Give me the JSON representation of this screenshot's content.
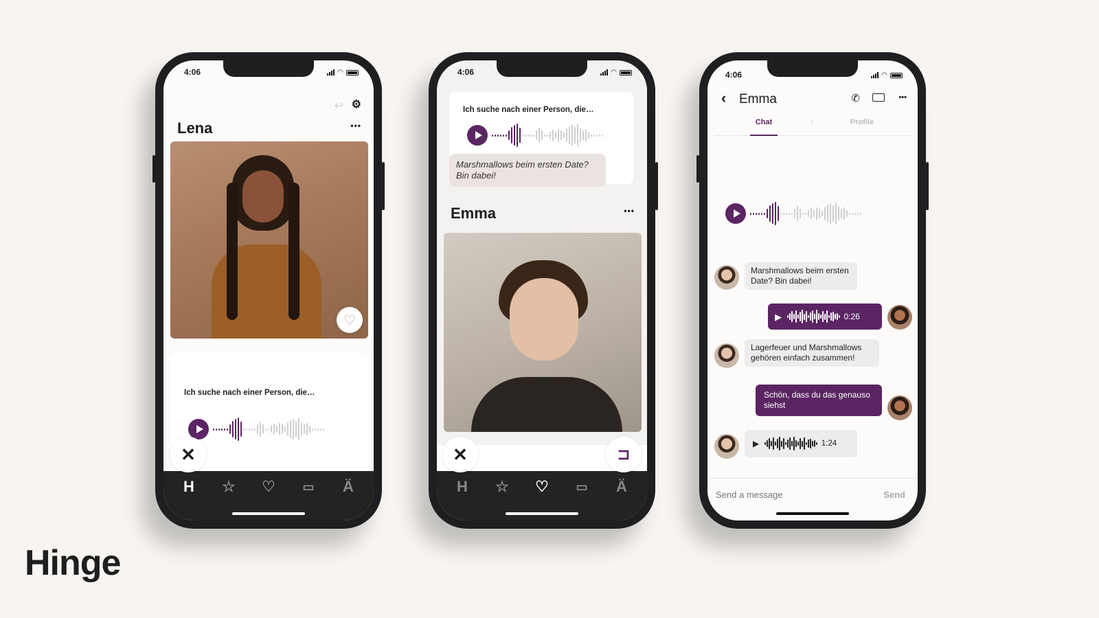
{
  "brand": {
    "logo_text": "Hinge",
    "accent_color": "#5b2563"
  },
  "status_bar": {
    "time": "4:06"
  },
  "phone1": {
    "profile_name": "Lena",
    "more_label": "•••",
    "voice_prompt": "Ich suche nach einer Person, die…",
    "icons": [
      "undo-icon",
      "filter-icon",
      "heart-icon",
      "close-icon"
    ],
    "tabbar": [
      {
        "name": "home",
        "label": "H",
        "active": true
      },
      {
        "name": "standouts",
        "label": "☆",
        "active": false
      },
      {
        "name": "likes",
        "label": "♡",
        "active": false
      },
      {
        "name": "matches",
        "label": "💬",
        "active": false
      },
      {
        "name": "profile",
        "label": "⛀",
        "active": false
      }
    ]
  },
  "phone2": {
    "voice_prompt": "Ich suche nach einer Person, die…",
    "comment": "Marshmallows beim ersten Date? Bin dabei!",
    "profile_name": "Emma",
    "more_label": "•••",
    "tabbar_active": "likes"
  },
  "phone3": {
    "header_name": "Emma",
    "back_label": "‹",
    "more_label": "•••",
    "tabs": [
      {
        "label": "Chat",
        "active": true
      },
      {
        "label": "Profile",
        "active": false
      }
    ],
    "messages": [
      {
        "from": "emma",
        "type": "text",
        "text": "Marshmallows beim ersten Date? Bin dabei!"
      },
      {
        "from": "me",
        "type": "voice",
        "duration": "0:26"
      },
      {
        "from": "emma",
        "type": "text",
        "text": "Lagerfeuer und Marshmallows gehören einfach zusammen!"
      },
      {
        "from": "me",
        "type": "text",
        "text": "Schön, dass du das genauso siehst"
      },
      {
        "from": "emma",
        "type": "voice",
        "duration": "1:24"
      }
    ],
    "composer": {
      "placeholder": "Send a message",
      "send_label": "Send"
    }
  }
}
